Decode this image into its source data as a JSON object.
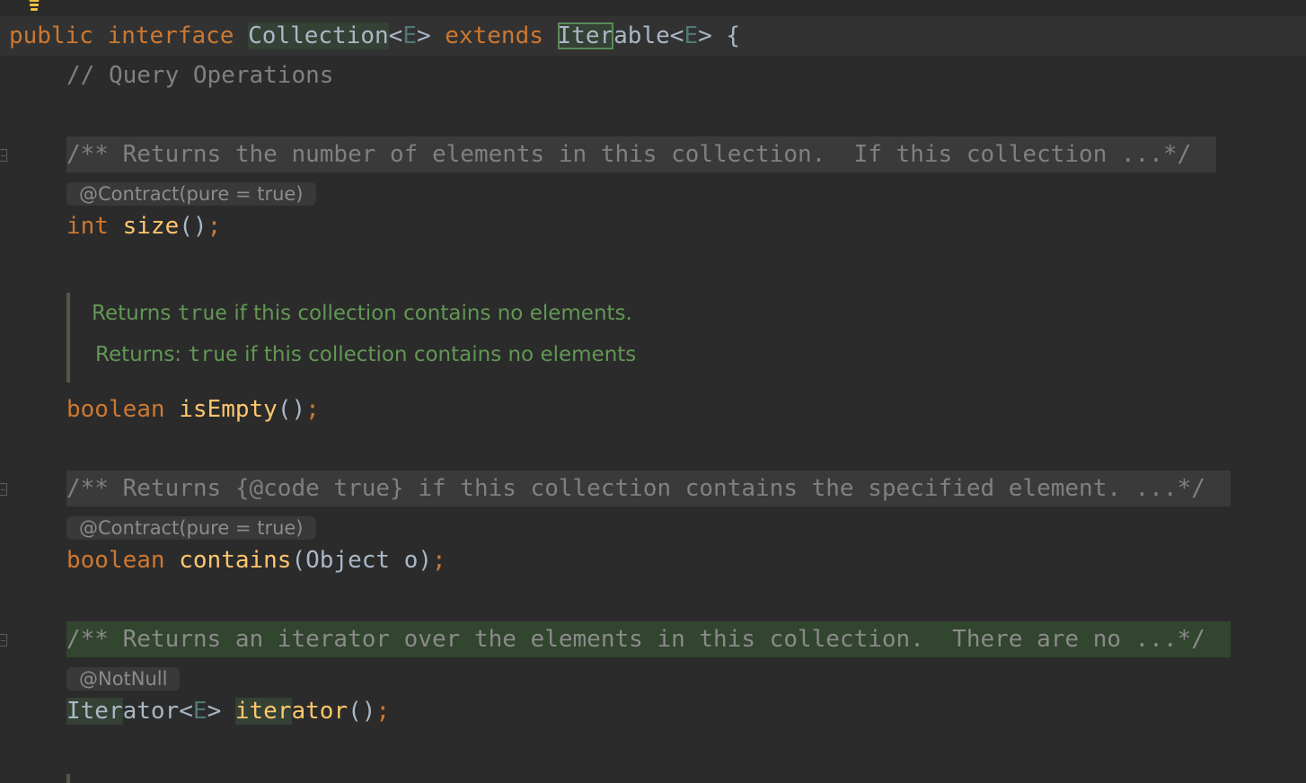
{
  "editor": {
    "line1": {
      "kw_public": "public",
      "kw_interface": "interface",
      "class_name": "Collection",
      "lt1": "<",
      "tparam1": "E",
      "gt1": ">",
      "kw_extends": "extends",
      "iter_hl": "Iter",
      "iter_rest": "able",
      "lt2": "<",
      "tparam2": "E",
      "gt2": ">",
      "brace": "{"
    },
    "comment_query": "// Query Operations",
    "size_doc": "/** Returns the number of elements in this collection.  If this collection ...*/",
    "size_hint": "@Contract(pure = true)",
    "size_line": {
      "kw": "int",
      "name": "size",
      "parens": "()",
      "semi": ";"
    },
    "isEmpty_doc": {
      "p1_a": "Returns ",
      "p1_code": "true",
      "p1_b": " if this collection contains no elements.",
      "p2_a": "Returns: ",
      "p2_code": "true",
      "p2_b": " if this collection contains no elements"
    },
    "isEmpty_line": {
      "kw": "boolean",
      "name": "isEmpty",
      "parens": "()",
      "semi": ";"
    },
    "contains_doc": "/** Returns {@code true} if this collection contains the specified element. ...*/",
    "contains_hint": "@Contract(pure = true)",
    "contains_line": {
      "kw": "boolean",
      "name": "contains",
      "open": "(",
      "param_type": "Object",
      "param_name": " o",
      "close": ")",
      "semi": ";"
    },
    "iterator_doc": "/** Returns an iterator over the elements in this collection.  There are no ...*/",
    "iterator_hint": "@NotNull",
    "iterator_line": {
      "ret_hl": "Iter",
      "ret_rest": "ator",
      "lt": "<",
      "tparam": "E",
      "gt": ">",
      "name_hl": "iter",
      "name_rest": "ator",
      "parens": "()",
      "semi": ";"
    }
  },
  "colors": {
    "background": "#2b2b2b",
    "keyword": "#cc7832",
    "method": "#ffc66d",
    "comment": "#808080",
    "doc_comment": "#629755",
    "usage_highlight": "#344134"
  },
  "icons": {
    "intention": "lightbulb-icon",
    "fold": "fold-marker-icon"
  }
}
